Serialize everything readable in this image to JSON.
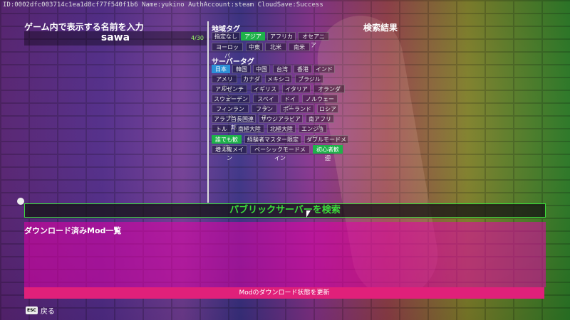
{
  "debug_line": "ID:0002dfc003714c1ea1d8cf77f540f1b6   Name:yukino   AuthAccount:steam   CloudSave:Success",
  "left": {
    "name_heading": "ゲーム内で表示する名前を入力",
    "name_value": "sawa",
    "name_counter": "4/30"
  },
  "region": {
    "heading": "地域タグ",
    "chips": [
      {
        "label": "指定なし",
        "state": "normal"
      },
      {
        "label": "アジア",
        "state": "green"
      },
      {
        "label": "アフリカ",
        "state": "normal"
      },
      {
        "label": "オセアニア",
        "state": "normal"
      },
      {
        "label": "ヨーロッパ",
        "state": "normal"
      },
      {
        "label": "中東",
        "state": "normal"
      },
      {
        "label": "北米",
        "state": "normal"
      },
      {
        "label": "南米",
        "state": "normal"
      }
    ]
  },
  "server": {
    "heading": "サーバータグ",
    "chips": [
      {
        "label": "日本",
        "state": "blue"
      },
      {
        "label": "韓国",
        "state": "normal"
      },
      {
        "label": "中国",
        "state": "normal"
      },
      {
        "label": "台湾",
        "state": "normal"
      },
      {
        "label": "香港",
        "state": "normal"
      },
      {
        "label": "インド",
        "state": "normal"
      },
      {
        "label": "アメリカ",
        "state": "normal"
      },
      {
        "label": "カナダ",
        "state": "normal"
      },
      {
        "label": "メキシコ",
        "state": "normal"
      },
      {
        "label": "ブラジル",
        "state": "normal"
      },
      {
        "label": "アルゼンチン",
        "state": "normal"
      },
      {
        "label": "イギリス",
        "state": "normal"
      },
      {
        "label": "イタリア",
        "state": "normal"
      },
      {
        "label": "オランダ",
        "state": "normal"
      },
      {
        "label": "スウェーデン",
        "state": "normal"
      },
      {
        "label": "スペイン",
        "state": "normal"
      },
      {
        "label": "ドイツ",
        "state": "normal"
      },
      {
        "label": "ノルウェー",
        "state": "normal"
      },
      {
        "label": "フィンランド",
        "state": "normal"
      },
      {
        "label": "フランス",
        "state": "normal"
      },
      {
        "label": "ポーランド",
        "state": "normal"
      },
      {
        "label": "ロシア",
        "state": "normal"
      },
      {
        "label": "アラブ首長国連邦",
        "state": "normal"
      },
      {
        "label": "サウジアラビア",
        "state": "normal"
      },
      {
        "label": "南アフリカ",
        "state": "normal"
      },
      {
        "label": "トルコ",
        "state": "normal"
      },
      {
        "label": "南極大陸",
        "state": "normal"
      },
      {
        "label": "北極大陸",
        "state": "normal"
      },
      {
        "label": "エンジョイ",
        "state": "normal"
      },
      {
        "label": "誰でも歓迎",
        "state": "green"
      },
      {
        "label": "経験者マスター限定",
        "state": "normal"
      },
      {
        "label": "ダブルモードメイン",
        "state": "normal"
      },
      {
        "label": "増え鬼メイン",
        "state": "normal"
      },
      {
        "label": "ベーシックモードメイン",
        "state": "normal"
      },
      {
        "label": "初心者歓迎",
        "state": "green"
      }
    ]
  },
  "results_heading": "検索結果",
  "search_button": "パブリックサーバーを検索",
  "mods": {
    "heading": "ダウンロード済みMod一覧",
    "update_button": "Modのダウンロード状態を更新"
  },
  "back": {
    "key": "ESC",
    "label": "戻る"
  }
}
